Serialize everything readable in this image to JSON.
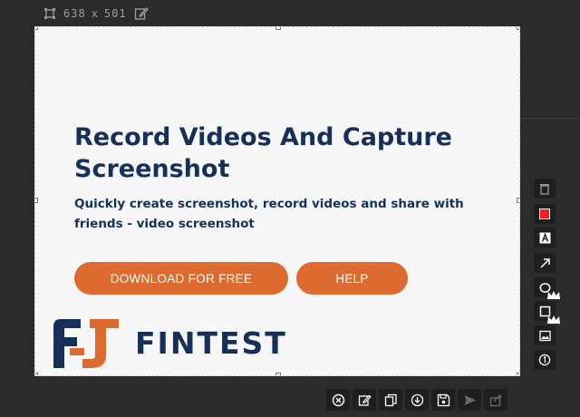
{
  "toolbar_top": {
    "width_value": "638",
    "separator": "x",
    "height_value": "501",
    "icons": [
      "crop-icon",
      "edit-icon"
    ]
  },
  "capture_content": {
    "headline": "Record Videos And Capture Screenshot",
    "subline": "Quickly create screenshot, record videos and share with friends - video screenshot",
    "download_label": "DOWNLOAD FOR FREE",
    "help_label": "HELP",
    "logo_text": "FINTEST"
  },
  "side_tools": [
    {
      "name": "trash-icon"
    },
    {
      "name": "color-swatch-red"
    },
    {
      "name": "text-tool-icon"
    },
    {
      "name": "arrow-tool-icon"
    },
    {
      "name": "ellipse-tool-icon"
    },
    {
      "name": "rectangle-tool-icon",
      "premium": true
    },
    {
      "name": "image-tool-icon",
      "premium": true
    },
    {
      "name": "numbered-marker-icon"
    }
  ],
  "bottom_tools": [
    {
      "name": "close-icon"
    },
    {
      "name": "edit-icon"
    },
    {
      "name": "copy-icon"
    },
    {
      "name": "download-icon"
    },
    {
      "name": "save-icon"
    },
    {
      "name": "send-icon",
      "disabled": true
    },
    {
      "name": "share-icon",
      "disabled": true
    }
  ],
  "colors": {
    "background": "#2b2b2b",
    "capture_bg": "#f7f7f8",
    "brand_navy": "#16305a",
    "brand_orange": "#dd6a2f",
    "swatch_red": "#ff1a1a"
  }
}
